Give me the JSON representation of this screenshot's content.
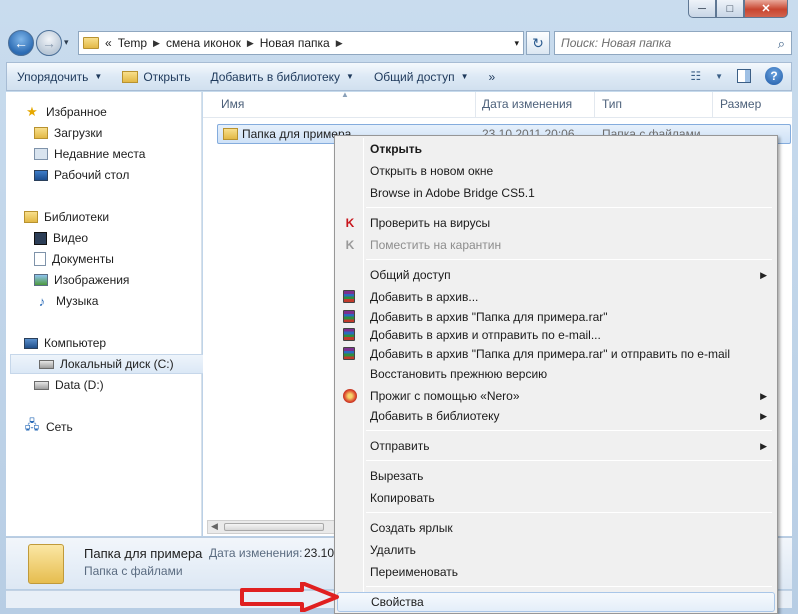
{
  "window": {
    "controls": {
      "minimize": "─",
      "maximize": "□",
      "close": "✕"
    }
  },
  "navbar": {
    "back": "←",
    "forward": "→",
    "dropdown": "▾",
    "breadcrumb_prefix": "«",
    "breadcrumbs": [
      "Temp",
      "смена иконок",
      "Новая папка"
    ],
    "refresh": "↻",
    "search_placeholder": "Поиск: Новая папка",
    "search_icon": "⌕"
  },
  "commandbar": {
    "organize": "Упорядочить",
    "open": "Открыть",
    "add_to_library": "Добавить в библиотеку",
    "share": "Общий доступ",
    "more": "»",
    "view_icon": "☷",
    "help": "?"
  },
  "navpane": {
    "favorites": {
      "label": "Избранное",
      "items": [
        "Загрузки",
        "Недавние места",
        "Рабочий стол"
      ]
    },
    "libraries": {
      "label": "Библиотеки",
      "items": [
        "Видео",
        "Документы",
        "Изображения",
        "Музыка"
      ]
    },
    "computer": {
      "label": "Компьютер",
      "items": [
        "Локальный диск (C:)",
        "Data (D:)"
      ]
    },
    "network": {
      "label": "Сеть"
    }
  },
  "columns": {
    "name": "Имя",
    "date": "Дата изменения",
    "type": "Тип",
    "size": "Размер"
  },
  "file_row": {
    "name": "Папка для примера",
    "date": "23.10.2011 20:06",
    "type": "Папка с файлами"
  },
  "details": {
    "name": "Папка для примера",
    "type": "Папка с файлами",
    "date_label": "Дата изменения:",
    "date_value": "23.10..."
  },
  "context_menu": {
    "open": "Открыть",
    "open_new_window": "Открыть в новом окне",
    "bridge": "Browse in Adobe Bridge CS5.1",
    "scan": "Проверить на вирусы",
    "quarantine": "Поместить на карантин",
    "share": "Общий доступ",
    "add_archive": "Добавить в архив...",
    "add_archive_rar": "Добавить в архив \"Папка для примера.rar\"",
    "add_archive_email": "Добавить в архив и отправить по e-mail...",
    "add_archive_rar_email": "Добавить в архив \"Папка для примера.rar\" и отправить по e-mail",
    "restore": "Восстановить прежнюю версию",
    "nero": "Прожиг с помощью «Nero»",
    "add_library": "Добавить в библиотеку",
    "send_to": "Отправить",
    "cut": "Вырезать",
    "copy": "Копировать",
    "create_shortcut": "Создать ярлык",
    "delete": "Удалить",
    "rename": "Переименовать",
    "properties": "Свойства",
    "submenu_arrow": "▶",
    "kaspersky_icon": "K"
  },
  "colors": {
    "selection": "#cfe2f7",
    "arrow": "#e02020",
    "menu_bg": "#f0f0f0"
  }
}
